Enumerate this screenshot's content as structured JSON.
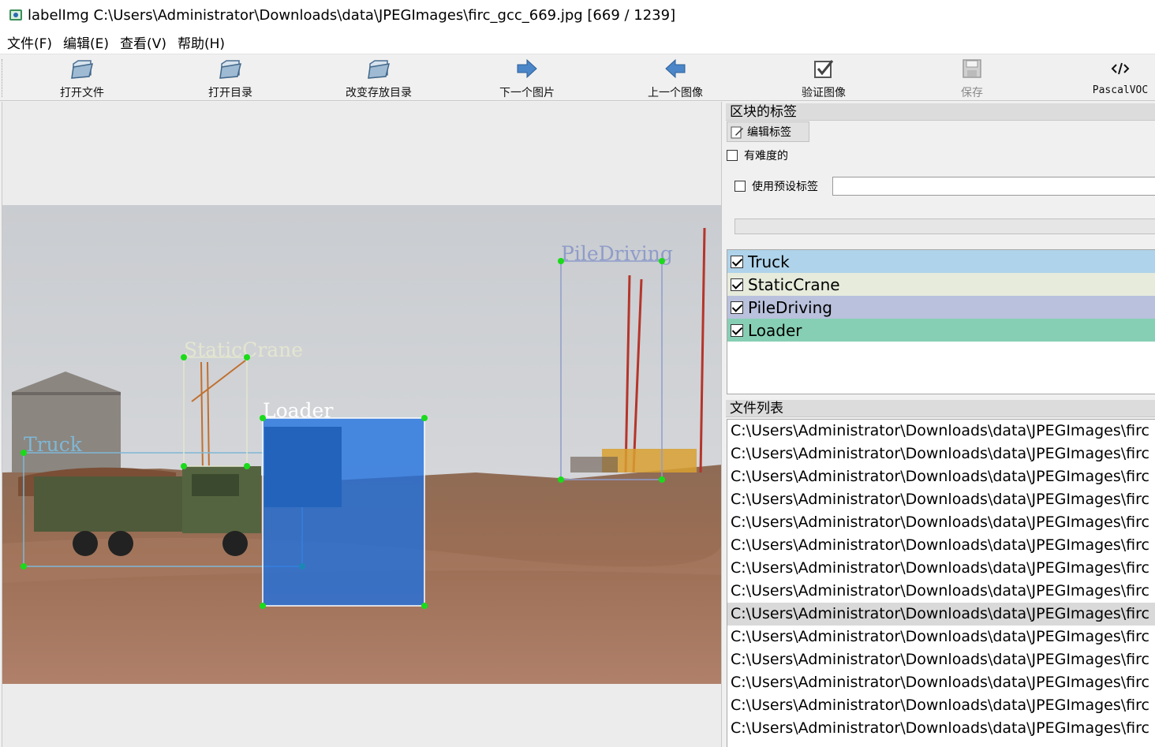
{
  "window": {
    "title": "labelImg C:\\Users\\Administrator\\Downloads\\data\\JPEGImages\\firc_gcc_669.jpg [669 / 1239]"
  },
  "menu": [
    {
      "label": "文件(F)"
    },
    {
      "label": "编辑(E)"
    },
    {
      "label": "查看(V)"
    },
    {
      "label": "帮助(H)"
    }
  ],
  "toolbar": [
    {
      "label": "打开文件",
      "icon": "open-file-icon",
      "enabled": true
    },
    {
      "label": "打开目录",
      "icon": "open-dir-icon",
      "enabled": true
    },
    {
      "label": "改变存放目录",
      "icon": "change-save-dir-icon",
      "enabled": true
    },
    {
      "label": "下一个图片",
      "icon": "next-arrow-icon",
      "enabled": true
    },
    {
      "label": "上一个图像",
      "icon": "prev-arrow-icon",
      "enabled": true
    },
    {
      "label": "验证图像",
      "icon": "verify-check-icon",
      "enabled": true
    },
    {
      "label": "保存",
      "icon": "save-disk-icon",
      "enabled": false
    },
    {
      "label": "PascalVOC",
      "icon": "format-code-icon",
      "enabled": true
    }
  ],
  "canvas": {
    "boxes": [
      {
        "label": "Truck",
        "color": "#7fb7d6"
      },
      {
        "label": "StaticCrane",
        "color": "#e3e6cf"
      },
      {
        "label": "PileDriving",
        "color": "#8f9cc9"
      },
      {
        "label": "Loader",
        "color": "#ffffff",
        "fill": "#1e6fe0"
      }
    ]
  },
  "dock": {
    "box_labels_title": "区块的标签",
    "edit_label_button": "编辑标签",
    "difficult_label": "有难度的",
    "use_default_label": "使用预设标签",
    "labels": [
      {
        "name": "Truck",
        "checked": true,
        "color": "#afd3ea"
      },
      {
        "name": "StaticCrane",
        "checked": true,
        "color": "#e6ebdc"
      },
      {
        "name": "PileDriving",
        "checked": true,
        "color": "#b9c1dc"
      },
      {
        "name": "Loader",
        "checked": true,
        "color": "#86cfb4"
      }
    ],
    "file_list_title": "文件列表",
    "files": [
      "C:\\Users\\Administrator\\Downloads\\data\\JPEGImages\\firc",
      "C:\\Users\\Administrator\\Downloads\\data\\JPEGImages\\firc",
      "C:\\Users\\Administrator\\Downloads\\data\\JPEGImages\\firc",
      "C:\\Users\\Administrator\\Downloads\\data\\JPEGImages\\firc",
      "C:\\Users\\Administrator\\Downloads\\data\\JPEGImages\\firc",
      "C:\\Users\\Administrator\\Downloads\\data\\JPEGImages\\firc",
      "C:\\Users\\Administrator\\Downloads\\data\\JPEGImages\\firc",
      "C:\\Users\\Administrator\\Downloads\\data\\JPEGImages\\firc",
      "C:\\Users\\Administrator\\Downloads\\data\\JPEGImages\\firc",
      "C:\\Users\\Administrator\\Downloads\\data\\JPEGImages\\firc",
      "C:\\Users\\Administrator\\Downloads\\data\\JPEGImages\\firc",
      "C:\\Users\\Administrator\\Downloads\\data\\JPEGImages\\firc",
      "C:\\Users\\Administrator\\Downloads\\data\\JPEGImages\\firc",
      "C:\\Users\\Administrator\\Downloads\\data\\JPEGImages\\firc"
    ],
    "selected_file_index": 8
  }
}
